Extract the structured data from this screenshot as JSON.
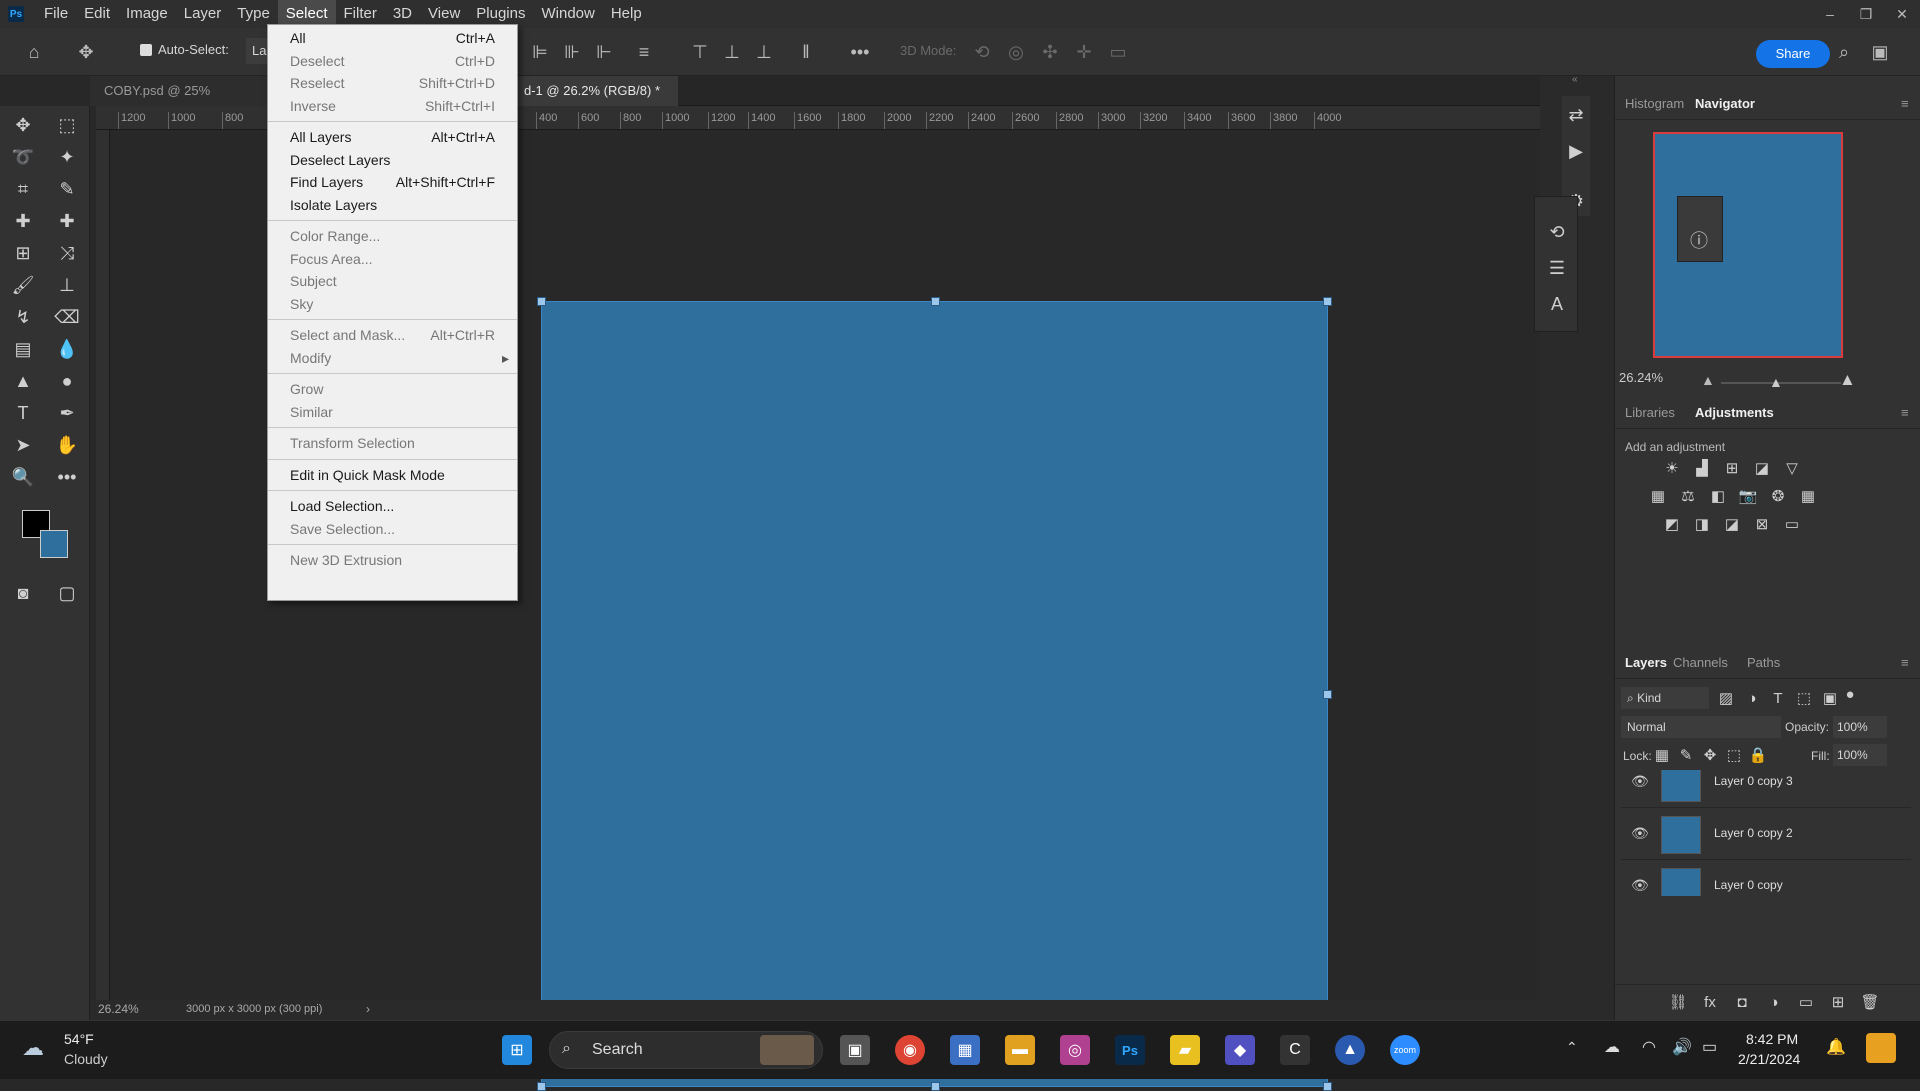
{
  "menubar": {
    "items": [
      "File",
      "Edit",
      "Image",
      "Layer",
      "Type",
      "Select",
      "Filter",
      "3D",
      "View",
      "Plugins",
      "Window",
      "Help"
    ],
    "active": "Select"
  },
  "options": {
    "auto_select": "Auto-Select:",
    "auto_select_value": "La",
    "mode_label": "3D Mode:",
    "share": "Share"
  },
  "doc_tabs": [
    {
      "label": "COBY.psd @ 25% (Selecti"
    },
    {
      "label": "d-1 @ 26.2% (RGB/8) *"
    }
  ],
  "ruler": [
    "1200",
    "1000",
    "800",
    "400",
    "600",
    "800",
    "1000",
    "1200",
    "1400",
    "1600",
    "1800",
    "2000",
    "2200",
    "2400",
    "2600",
    "2800",
    "3000",
    "3200",
    "3400",
    "3600",
    "3800",
    "4000"
  ],
  "select_menu": {
    "groups": [
      [
        {
          "label": "All",
          "shortcut": "Ctrl+A",
          "enabled": true
        },
        {
          "label": "Deselect",
          "shortcut": "Ctrl+D",
          "enabled": false
        },
        {
          "label": "Reselect",
          "shortcut": "Shift+Ctrl+D",
          "enabled": false
        },
        {
          "label": "Inverse",
          "shortcut": "Shift+Ctrl+I",
          "enabled": false
        }
      ],
      [
        {
          "label": "All Layers",
          "shortcut": "Alt+Ctrl+A",
          "enabled": true
        },
        {
          "label": "Deselect Layers",
          "shortcut": "",
          "enabled": true
        },
        {
          "label": "Find Layers",
          "shortcut": "Alt+Shift+Ctrl+F",
          "enabled": true
        },
        {
          "label": "Isolate Layers",
          "shortcut": "",
          "enabled": true
        }
      ],
      [
        {
          "label": "Color Range...",
          "shortcut": "",
          "enabled": false
        },
        {
          "label": "Focus Area...",
          "shortcut": "",
          "enabled": false
        },
        {
          "label": "Subject",
          "shortcut": "",
          "enabled": false
        },
        {
          "label": "Sky",
          "shortcut": "",
          "enabled": false
        }
      ],
      [
        {
          "label": "Select and Mask...",
          "shortcut": "Alt+Ctrl+R",
          "enabled": false
        },
        {
          "label": "Modify",
          "shortcut": "",
          "enabled": false,
          "submenu": true
        }
      ],
      [
        {
          "label": "Grow",
          "shortcut": "",
          "enabled": false
        },
        {
          "label": "Similar",
          "shortcut": "",
          "enabled": false
        }
      ],
      [
        {
          "label": "Transform Selection",
          "shortcut": "",
          "enabled": false
        }
      ],
      [
        {
          "label": "Edit in Quick Mask Mode",
          "shortcut": "",
          "enabled": true
        }
      ],
      [
        {
          "label": "Load Selection...",
          "shortcut": "",
          "enabled": true
        },
        {
          "label": "Save Selection...",
          "shortcut": "",
          "enabled": false
        }
      ],
      [
        {
          "label": "New 3D Extrusion",
          "shortcut": "",
          "enabled": false
        }
      ]
    ]
  },
  "status": {
    "zoom": "26.24%",
    "doc_info": "3000 px x 3000 px (300 ppi)"
  },
  "navigator": {
    "tabs": [
      "Histogram",
      "Navigator"
    ],
    "zoom": "26.24%"
  },
  "adjustments": {
    "tabs": [
      "Libraries",
      "Adjustments"
    ],
    "hint": "Add an adjustment"
  },
  "layers": {
    "tabs": [
      "Layers",
      "Channels",
      "Paths"
    ],
    "kind": "Kind",
    "blend": "Normal",
    "opacity_label": "Opacity:",
    "opacity": "100%",
    "lock_label": "Lock:",
    "fill_label": "Fill:",
    "fill": "100%",
    "rows": [
      "Layer 0 copy 3",
      "Layer 0 copy 2",
      "Layer 0 copy"
    ]
  },
  "taskbar": {
    "temp": "54°F",
    "weather": "Cloudy",
    "search": "Search",
    "time": "8:42 PM",
    "date": "2/21/2024"
  },
  "colors": {
    "canvas": "#2e6f9e",
    "accent": "#1473e6"
  }
}
